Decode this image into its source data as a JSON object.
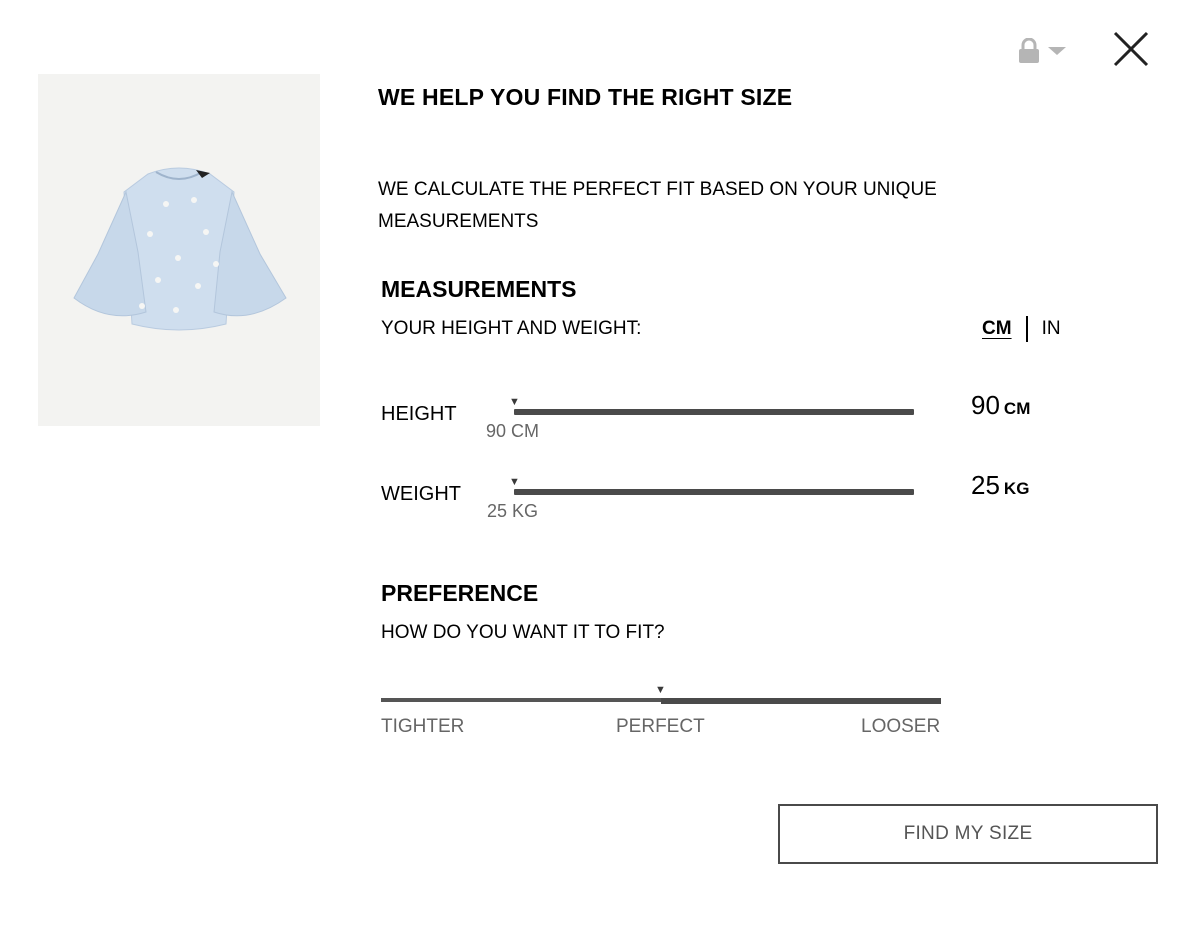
{
  "header": {
    "title": "WE HELP YOU FIND THE RIGHT SIZE",
    "intro": "WE CALCULATE THE PERFECT FIT BASED ON YOUR UNIQUE MEASUREMENTS"
  },
  "icons": {
    "lock": "lock-icon",
    "dropdown": "chevron-down-icon",
    "close": "close-icon"
  },
  "product": {
    "image": "light blue bell-sleeve blouse",
    "background": "#f3f3f1",
    "garment_color": "#cfdeee"
  },
  "measurements": {
    "title": "MEASUREMENTS",
    "subtitle": "YOUR HEIGHT AND WEIGHT:",
    "units": {
      "active": "CM",
      "options": [
        "CM",
        "IN"
      ]
    },
    "height": {
      "label": "HEIGHT",
      "caption": "90 CM",
      "value": "90",
      "unit": "CM",
      "level": 0
    },
    "weight": {
      "label": "WEIGHT",
      "caption": "25 KG",
      "value": "25",
      "unit": "KG",
      "level": 0
    }
  },
  "preference": {
    "title": "PREFERENCE",
    "subtitle": "HOW DO YOU WANT IT TO FIT?",
    "labels": [
      "TIGHTER",
      "PERFECT",
      "LOOSER"
    ],
    "selected": "PERFECT",
    "level": 0.5
  },
  "actions": {
    "find_size": "FIND MY SIZE"
  },
  "colors": {
    "track": "#4a4a4a",
    "caption": "#666666",
    "lock": "#b5b5b5"
  }
}
